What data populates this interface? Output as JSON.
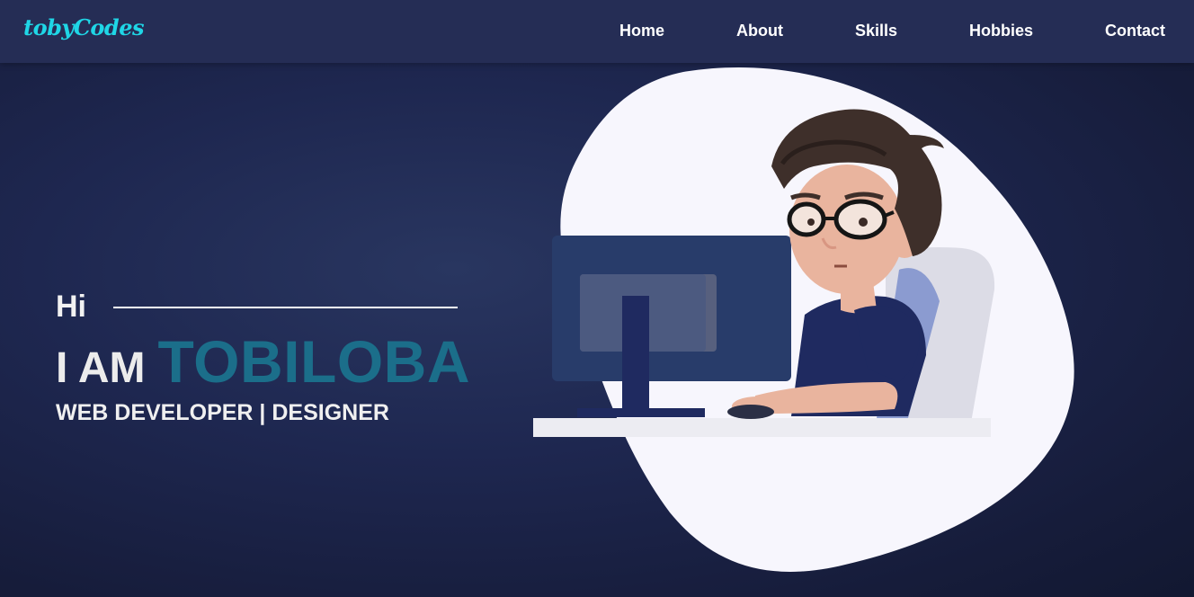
{
  "navbar": {
    "logo": "tobyCodes",
    "links": [
      "Home",
      "About",
      "Skills",
      "Hobbies",
      "Contact"
    ]
  },
  "hero": {
    "greeting": "Hi",
    "intro": "I AM",
    "name": "TOBILOBA",
    "role": "WEB DEVELOPER | DESIGNER"
  },
  "colors": {
    "background": "#1e2750",
    "navbar": "#252d55",
    "logo": "#1fd6e6",
    "name_accent": "#1b6e8a",
    "blob": "#f7f6fd"
  },
  "illustration": {
    "icon": "developer-at-computer-illustration"
  }
}
